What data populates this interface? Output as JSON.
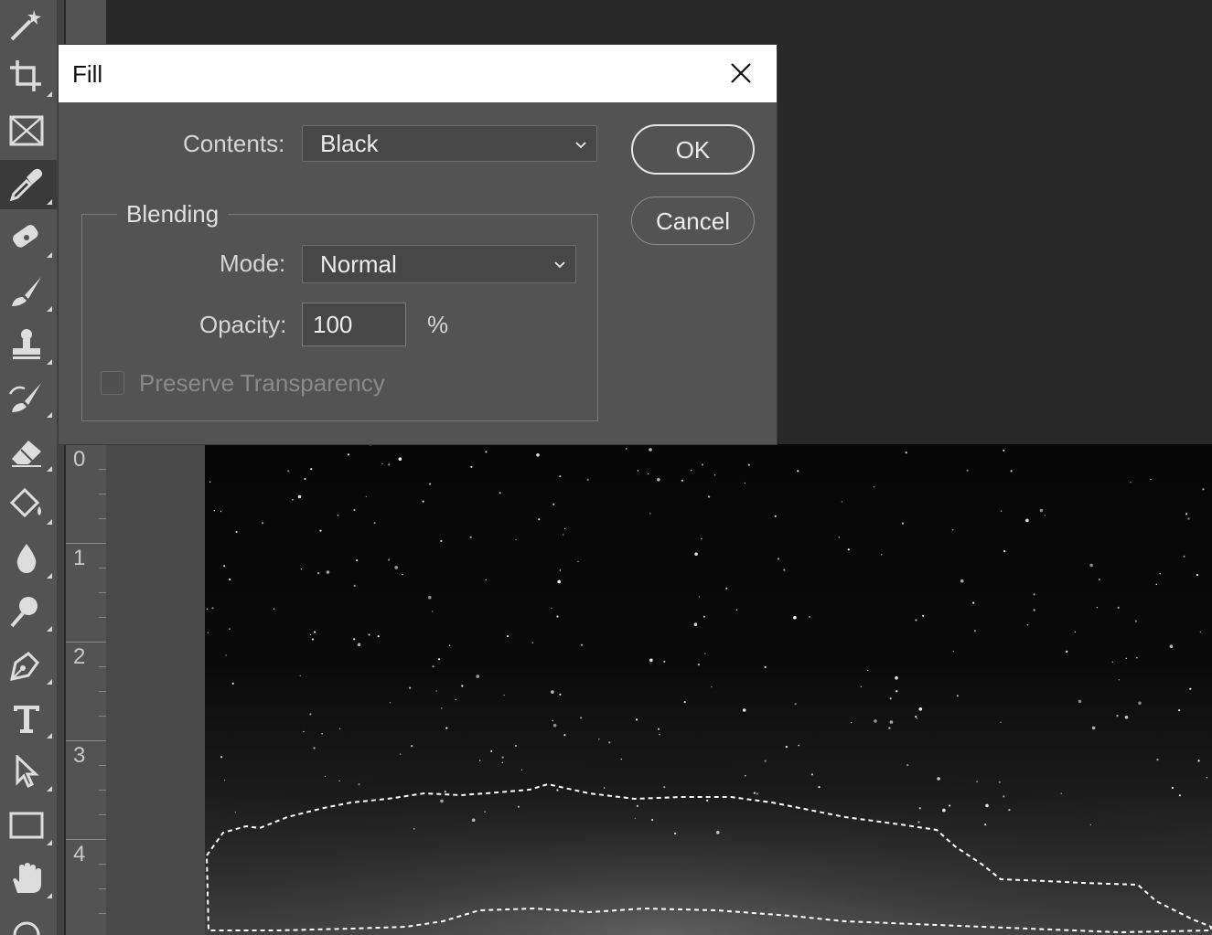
{
  "dialog": {
    "title": "Fill",
    "contents_label": "Contents:",
    "contents_value": "Black",
    "blending_legend": "Blending",
    "mode_label": "Mode:",
    "mode_value": "Normal",
    "opacity_label": "Opacity:",
    "opacity_value": "100",
    "opacity_unit": "%",
    "preserve_transparency_label": "Preserve Transparency",
    "preserve_transparency_checked": false,
    "preserve_transparency_enabled": false,
    "ok_label": "OK",
    "cancel_label": "Cancel"
  },
  "ruler": {
    "labels": [
      "0",
      "1",
      "2",
      "3",
      "4"
    ]
  },
  "toolbar": {
    "tools": [
      "magic-wand-icon",
      "crop-icon",
      "frame-icon",
      "eyedropper-icon",
      "spot-healing-brush-icon",
      "brush-icon",
      "clone-stamp-icon",
      "history-brush-icon",
      "eraser-icon",
      "paint-bucket-icon",
      "blur-icon",
      "dodge-icon",
      "pen-icon",
      "type-icon",
      "path-selection-icon",
      "rectangle-icon",
      "hand-icon",
      "rotate-view-icon"
    ],
    "active_tool": "eyedropper-icon"
  },
  "colors": {
    "toolbar_bg": "#535353",
    "dialog_bg": "#535353",
    "titlebar_bg": "#ffffff",
    "workspace_bg": "#282828"
  }
}
